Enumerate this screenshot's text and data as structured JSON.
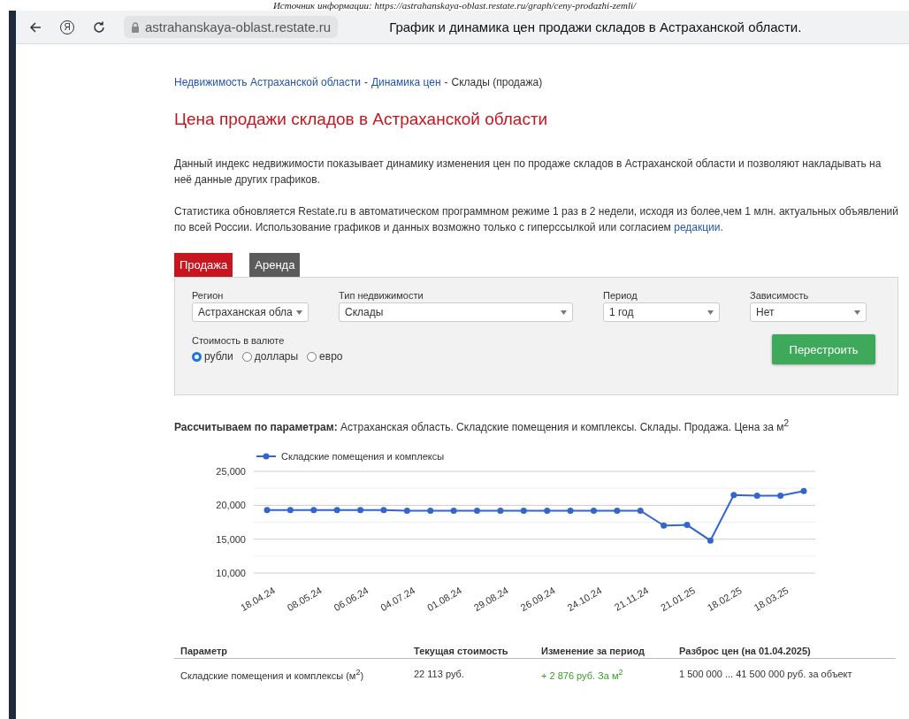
{
  "caption": "Источник информации: https://astrahanskaya-oblast.restate.ru/graph/ceny-prodazhi-zemli/",
  "browser": {
    "logo": "Я",
    "url": "astrahanskaya-oblast.restate.ru",
    "title": "График и динамика цен продажи складов в Астраханской области."
  },
  "breadcrumbs": {
    "separator": "-",
    "items": [
      {
        "label": "Недвижимость Астраханской области",
        "kind": "link"
      },
      {
        "label": "Динамика цен",
        "kind": "link"
      },
      {
        "label": "Склады (продажа)",
        "kind": "current"
      }
    ]
  },
  "heading": "Цена продажи складов в Астраханской области",
  "intro": "Данный индекс недвижимости показывает динамику изменения цен по продаже складов в Астраханской области и позволяют накладывать на неё данные других графиков.",
  "stats": {
    "text": "Статистика обновляется Restate.ru в автоматическом программном режиме 1 раз в 2 недели, исходя из более,чем 1 млн. актуальных объявлений по всей России. Использование графиков и данных возможно только с гиперссылкой или согласием",
    "link": "редакции."
  },
  "tabs": [
    {
      "label": "Продажа",
      "selected": true
    },
    {
      "label": "Аренда",
      "selected": false
    }
  ],
  "filters": [
    {
      "label": "Регион",
      "value": "Астраханская обла"
    },
    {
      "label": "Тип недвижимости",
      "value": "Склады"
    },
    {
      "label": "Период",
      "value": "1 год"
    },
    {
      "label": "Зависимость",
      "value": "Нет"
    }
  ],
  "currency": {
    "label": "Стоимость в валюте",
    "options": [
      {
        "label": "рубли",
        "selected": true
      },
      {
        "label": "доллары",
        "selected": false
      },
      {
        "label": "евро",
        "selected": false
      }
    ]
  },
  "rebuild_button": "Перестроить",
  "params": {
    "label": "Рассчитываем по параметрам:",
    "text": "Астраханская область. Складские помещения и комплексы. Склады. Продажа. Цена за м$^{2}$"
  },
  "chart_data": {
    "type": "line",
    "categories": [
      "18.04.24",
      null,
      "08.05.24",
      null,
      "06.06.24",
      null,
      "04.07.24",
      null,
      "01.08.24",
      null,
      "29.08.24",
      null,
      "26.09.24",
      null,
      "24.10.24",
      null,
      "21.11.24",
      null,
      "21.01.25",
      null,
      "18.02.25",
      null,
      "18.03.25",
      null
    ],
    "series": [
      {
        "name": "Складские помещения и комплексы",
        "color": "#3366cc",
        "marker": "circle",
        "values": [
          19300,
          19300,
          19300,
          19300,
          19300,
          19300,
          19200,
          19200,
          19200,
          19200,
          19200,
          19200,
          19200,
          19200,
          19200,
          19200,
          19200,
          17000,
          17100,
          14800,
          21500,
          21400,
          21400,
          22100
        ]
      }
    ],
    "ylim": [
      10000,
      25000
    ],
    "yticks": [
      {
        "value": 10000,
        "label": "10,000"
      },
      {
        "value": 15000,
        "label": "15,000"
      },
      {
        "value": 20000,
        "label": "20,000"
      },
      {
        "value": 25000,
        "label": "25,000"
      }
    ]
  },
  "table": {
    "columns": [
      "Параметр",
      "Текущая стоимость",
      "Изменение за период",
      "Разброс цен (на 01.04.2025)"
    ],
    "rows": [
      {
        "cells": [
          {
            "text": "Складские помещения и комплексы (м$^{2}$)",
            "kind": "plain"
          },
          {
            "text": "22 113 руб.",
            "kind": "plain"
          },
          {
            "text": "+ 2 876 руб. За м$^{2}$",
            "kind": "positive"
          },
          {
            "text": "1 500 000 ... 41 500 000 руб. за объект",
            "kind": "plain"
          }
        ]
      }
    ]
  }
}
